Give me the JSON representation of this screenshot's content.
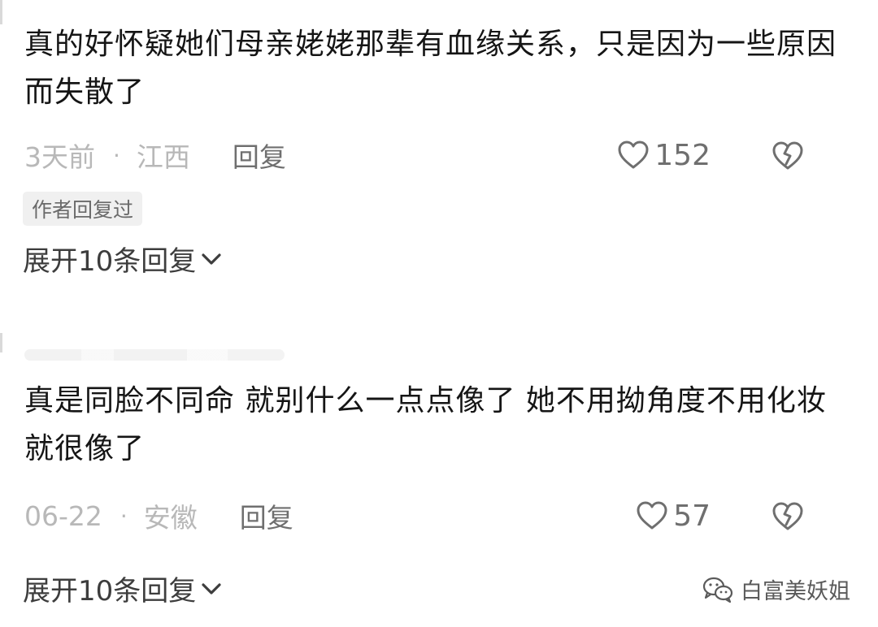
{
  "comments": [
    {
      "text": "真的好怀疑她们母亲姥姥那辈有血缘关系，只是因为一些原因而失散了",
      "time": "3天前",
      "separator": "·",
      "location": "江西",
      "reply_label": "回复",
      "likes": "152",
      "author_badge": "作者回复过",
      "expand_label": "展开10条回复"
    },
    {
      "text": "真是同脸不同命 就别什么一点点像了 她不用拗角度不用化妆就很像了",
      "time": "06-22",
      "separator": "·",
      "location": "安徽",
      "reply_label": "回复",
      "likes": "57",
      "expand_label": "展开10条回复"
    }
  ],
  "watermark": {
    "text": "白富美妖姐",
    "icon": "wechat-icon"
  },
  "icons": {
    "like": "heart-outline-icon",
    "dislike": "broken-heart-icon",
    "expand": "chevron-down-icon"
  },
  "colors": {
    "text": "#151515",
    "meta": "#b8b8b8",
    "secondary": "#6f6f6f",
    "badge_bg": "#f0f0f0"
  }
}
